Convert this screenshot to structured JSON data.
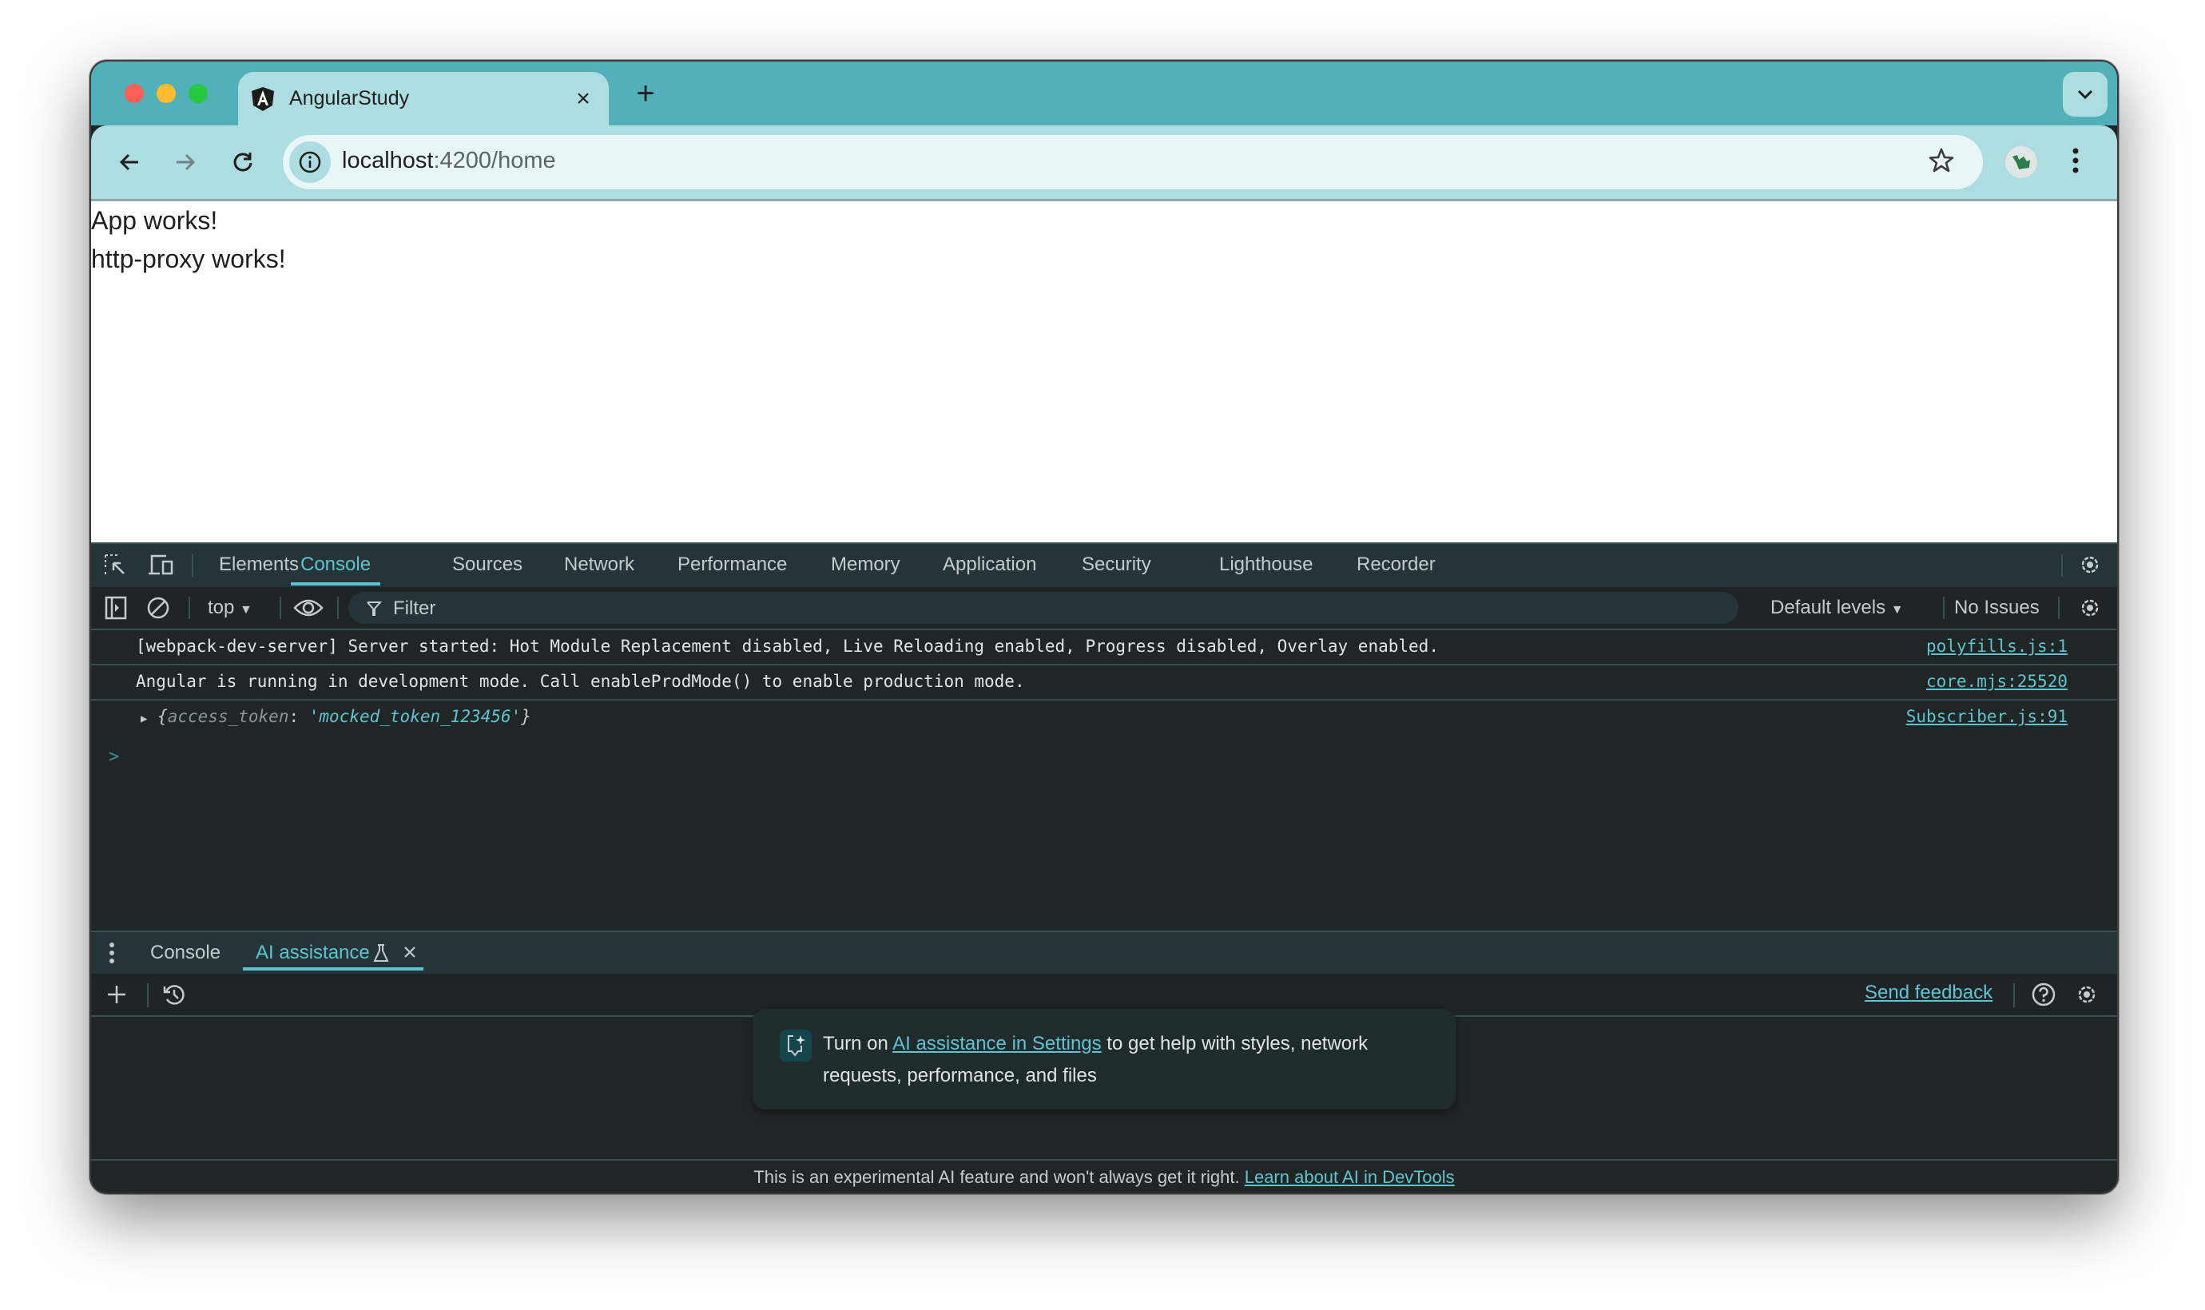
{
  "browser": {
    "traffic_lights": {
      "close": "#fe5f57",
      "minimize": "#febc2e",
      "zoom": "#28c840"
    },
    "tab": {
      "title": "AngularStudy",
      "favicon": "angular-icon",
      "close_label": "×"
    },
    "new_tab_label": "+",
    "url": {
      "host": "localhost",
      "rest": ":4200/home"
    },
    "accent": "#52b0b8"
  },
  "page": {
    "lines": [
      "App works!",
      "http-proxy works!"
    ]
  },
  "devtools": {
    "tabs": [
      "Elements",
      "Console",
      "Sources",
      "Network",
      "Performance",
      "Memory",
      "Application",
      "Security",
      "Lighthouse",
      "Recorder"
    ],
    "active_tab": "Console",
    "console_toolbar": {
      "context": "top",
      "filter_placeholder": "Filter",
      "levels": "Default levels",
      "issues": "No Issues"
    },
    "logs": [
      {
        "message": "[webpack-dev-server] Server started: Hot Module Replacement disabled, Live Reloading enabled, Progress disabled, Overlay enabled.",
        "source": "polyfills.js:1"
      },
      {
        "message": "Angular is running in development mode. Call enableProdMode() to enable production mode.",
        "source": "core.mjs:25520"
      },
      {
        "object_key": "access_token",
        "object_value": "'mocked_token_123456'",
        "source": "Subscriber.js:91"
      }
    ],
    "prompt": ">",
    "drawer": {
      "tabs": [
        "Console",
        "AI assistance"
      ],
      "active_tab": "AI assistance",
      "send_feedback": "Send feedback",
      "card": {
        "prefix": "Turn on ",
        "link": "AI assistance in Settings",
        "suffix": " to get help with styles, network requests, performance, and files"
      },
      "footer": {
        "text": "This is an experimental AI feature and won't always get it right. ",
        "link": "Learn about AI in DevTools"
      }
    },
    "link_color": "#5ec4d0"
  }
}
